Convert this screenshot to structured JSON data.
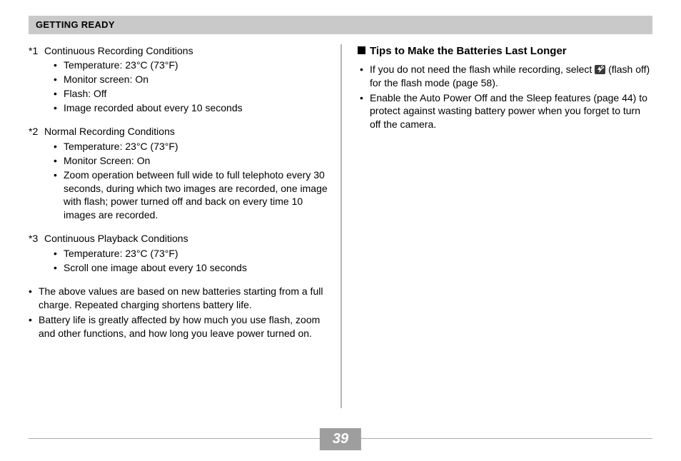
{
  "header": "GETTING READY",
  "page_number": "39",
  "left": {
    "footnotes": [
      {
        "ref": "*1",
        "title": "Continuous Recording Conditions",
        "items": [
          "Temperature: 23°C (73°F)",
          "Monitor screen: On",
          "Flash: Off",
          "Image recorded about every 10 seconds"
        ]
      },
      {
        "ref": "*2",
        "title": "Normal Recording Conditions",
        "items": [
          "Temperature: 23°C (73°F)",
          "Monitor Screen: On",
          "Zoom operation between full wide to full telephoto every 30 seconds, during which two images are recorded, one image with flash; power turned off and back on every time 10 images are recorded."
        ]
      },
      {
        "ref": "*3",
        "title": "Continuous Playback Conditions",
        "items": [
          "Temperature: 23°C (73°F)",
          "Scroll one image about every 10 seconds"
        ]
      }
    ],
    "notes": [
      "The above values are based on new batteries starting from a full charge. Repeated charging shortens battery life.",
      "Battery life is greatly affected by how much you use flash, zoom and other functions, and how long you leave power turned on."
    ]
  },
  "right": {
    "heading": "Tips to Make the Batteries Last Longer",
    "tips": [
      {
        "before_icon": "If you do not need the flash while recording, select ",
        "after_icon": " (flash off) for the flash mode (page 58).",
        "icon_name": "flash-off-icon"
      },
      {
        "before_icon": "Enable the Auto Power Off and the Sleep features (page 44) to protect against wasting battery power when you forget to turn off the camera.",
        "after_icon": "",
        "icon_name": null
      }
    ]
  }
}
